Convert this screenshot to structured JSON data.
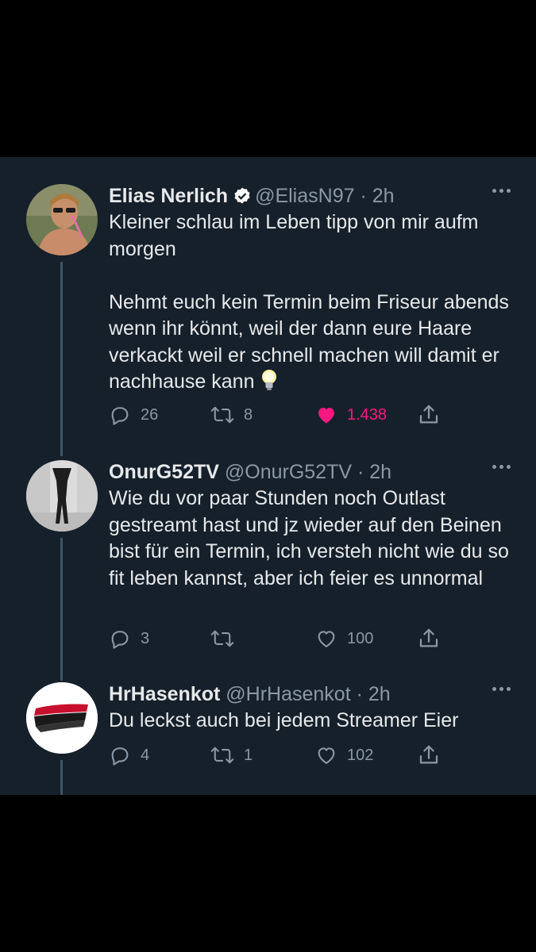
{
  "theme": {
    "background": "#15202b",
    "text": "#e7e9ea",
    "secondary": "#8b98a5",
    "like_active": "#f91880",
    "verified": "#ffffff"
  },
  "tweets": [
    {
      "name": "Elias Nerlich",
      "verified": true,
      "handle": "@EliasN97",
      "time": "· 2h",
      "paragraphs": [
        "Kleiner schlau im Leben tipp von mir aufm morgen",
        "Nehmt euch kein Termin beim Friseur abends wenn ihr könnt, weil der dann eure Haare verkackt weil er schnell machen will damit er nachhause kann"
      ],
      "emoji": "lightbulb-emoji",
      "replies": "26",
      "retweets": "8",
      "likes": "1.438",
      "liked": true
    },
    {
      "name": "OnurG52TV",
      "verified": false,
      "handle": "@OnurG52TV",
      "time": "· 2h",
      "paragraphs": [
        "Wie du vor paar Stunden noch Outlast gestreamt hast und jz wieder auf den Beinen bist für ein Termin, ich versteh nicht wie du so fit leben kannst, aber ich feier es unnormal"
      ],
      "replies": "3",
      "retweets": "",
      "likes": "100",
      "liked": false
    },
    {
      "name": "HrHasenkot",
      "verified": false,
      "handle": "@HrHasenkot",
      "time": "· 2h",
      "paragraphs": [
        "Du leckst auch bei jedem Streamer Eier"
      ],
      "replies": "4",
      "retweets": "1",
      "likes": "102",
      "liked": false
    }
  ],
  "icons": {
    "reply": "reply-icon",
    "retweet": "retweet-icon",
    "like": "heart-icon",
    "share": "share-icon",
    "more": "more-icon",
    "verified": "verified-badge-icon"
  }
}
